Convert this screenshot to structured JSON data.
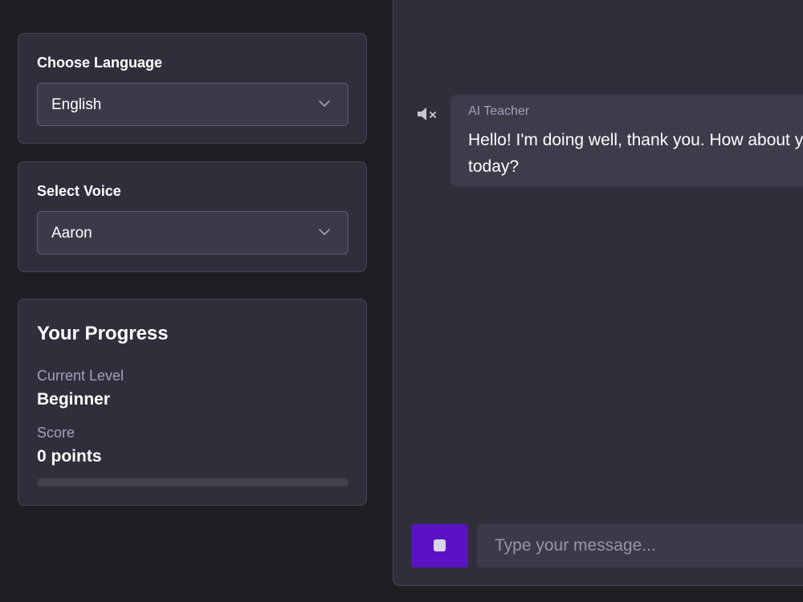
{
  "language": {
    "label": "Choose Language",
    "selected": "English"
  },
  "voice": {
    "label": "Select Voice",
    "selected": "Aaron"
  },
  "progress": {
    "title": "Your Progress",
    "level_label": "Current Level",
    "level_value": "Beginner",
    "score_label": "Score",
    "score_value": "0 points",
    "bar_fraction": 0
  },
  "chat": {
    "messages": [
      {
        "sender": "AI Teacher",
        "text": "Hello! I'm doing well, thank you. How about you today?"
      }
    ],
    "input_placeholder": "Type your message..."
  },
  "icons": {
    "speaker": "speaker-muted-icon",
    "chevron": "chevron-down-icon",
    "stop": "stop-icon"
  },
  "colors": {
    "background": "#1e1e22",
    "card": "#2f2f3c",
    "accent": "#5b12c4",
    "muted_text": "#a3a1be"
  }
}
